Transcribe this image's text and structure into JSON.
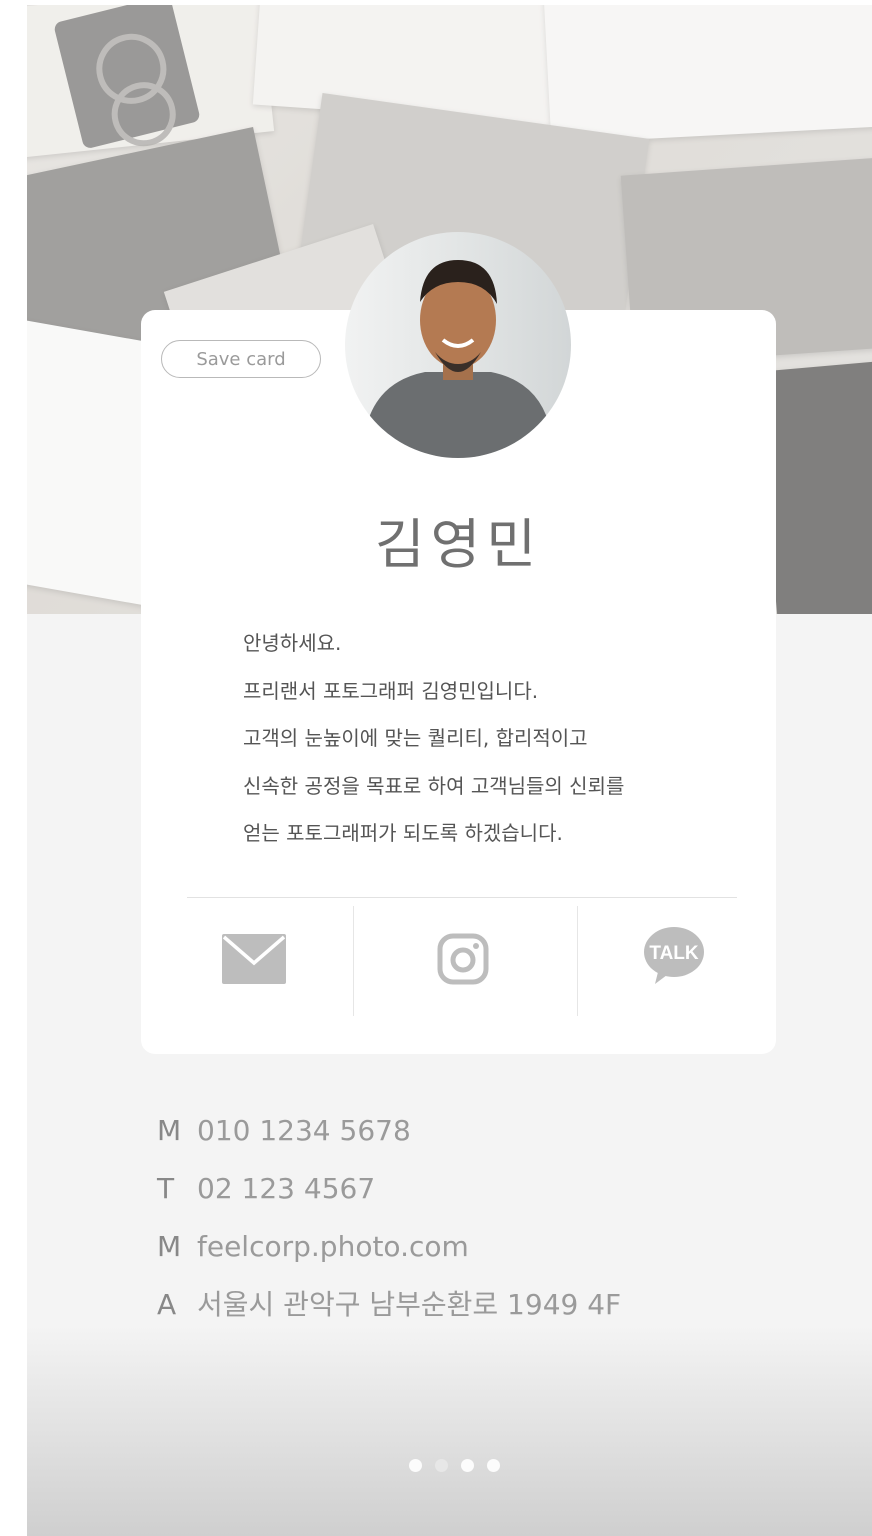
{
  "card": {
    "save_label": "Save card",
    "name": "김영민",
    "bio": [
      "안녕하세요.",
      "프리랜서 포토그래퍼 김영민입니다.",
      "고객의 눈높이에 맞는 퀄리티, 합리적이고",
      "신속한 공정을 목표로 하여 고객님들의 신뢰를",
      "얻는 포토그래퍼가 되도록 하겠습니다."
    ],
    "actions": [
      {
        "icon": "mail-icon"
      },
      {
        "icon": "instagram-icon"
      },
      {
        "icon": "kakaotalk-icon",
        "label": "TALK"
      }
    ]
  },
  "contacts": [
    {
      "key": "M",
      "value": "010 1234 5678"
    },
    {
      "key": "T",
      "value": "02 123 4567"
    },
    {
      "key": "M",
      "value": "feelcorp.photo.com"
    },
    {
      "key": "A",
      "value": "서울시 관악구 남부순환로 1949 4F"
    }
  ],
  "pagination": {
    "count": 4,
    "active": 1
  },
  "colors": {
    "icon": "#bdbdbd",
    "text": "#555555",
    "contact": "#9a9a9a"
  }
}
